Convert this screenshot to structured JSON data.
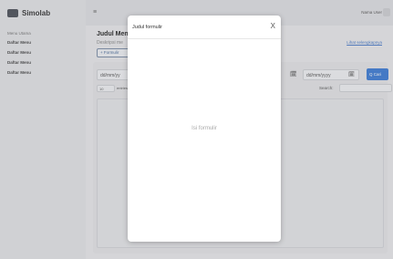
{
  "app": {
    "brand": "Simolab"
  },
  "sidebar": {
    "heading": "Menu Utama",
    "items": [
      {
        "label": "Daftar Menu"
      },
      {
        "label": "Daftar Menu"
      },
      {
        "label": "Daftar Menu"
      },
      {
        "label": "Daftar Menu"
      }
    ]
  },
  "topbar": {
    "menu_icon": "≡",
    "user_name": "Nama User"
  },
  "main": {
    "title": "Judul Men",
    "description": "Deskripsi me",
    "add_button": "+ Formulir",
    "add_link": "Lihat selengkapnya",
    "date_from": "dd/mm/yy",
    "date_to": "dd/mm/yyyy",
    "calendar_icon": "🗓",
    "search_button": "Q Cari",
    "per_page": "10",
    "entries_label": "entries",
    "search_label": "Search:"
  },
  "modal": {
    "title": "Judul formulir",
    "close": "X",
    "body_text": "Isi formulir"
  }
}
